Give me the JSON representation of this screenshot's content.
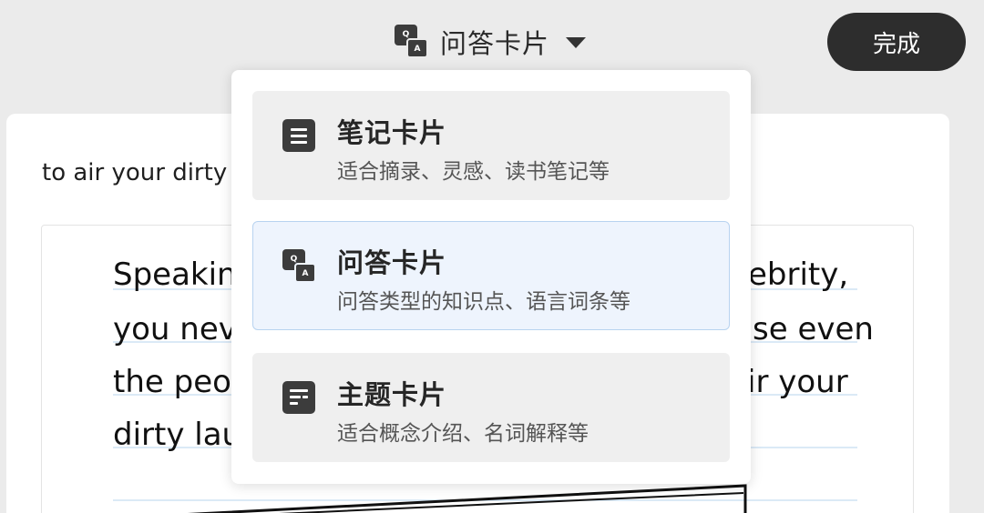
{
  "header": {
    "card_type_label": "问答卡片",
    "qa_icon": {
      "q": "Q",
      "a": "A"
    },
    "done_label": "完成"
  },
  "content": {
    "text": "to air your dirty",
    "note_lines": [
      "Speaking",
      "ebrity,",
      "you neve",
      "se even",
      "the peop",
      "ir your",
      "dirty lau"
    ]
  },
  "menu": {
    "items": [
      {
        "title": "笔记卡片",
        "desc": "适合摘录、灵感、读书笔记等",
        "icon": "note-icon",
        "selected": false
      },
      {
        "title": "问答卡片",
        "desc": "问答类型的知识点、语言词条等",
        "icon": "qa-icon",
        "selected": true
      },
      {
        "title": "主题卡片",
        "desc": "适合概念介绍、名词解释等",
        "icon": "topic-icon",
        "selected": false
      }
    ]
  },
  "colors": {
    "background": "#ebebeb",
    "selected_bg": "#eef4fd",
    "selected_border": "#b8d3f0",
    "button_bg": "#2d2d2d"
  }
}
